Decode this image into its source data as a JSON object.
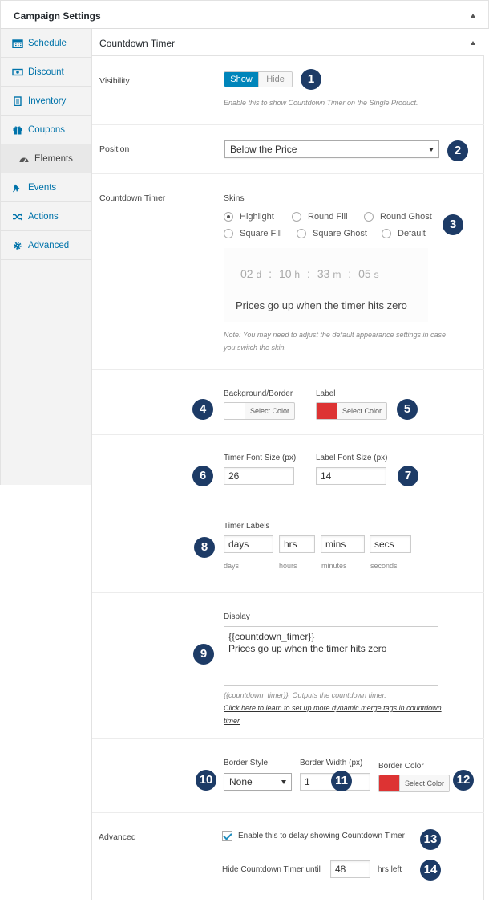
{
  "panel": {
    "title": "Campaign Settings"
  },
  "sidebar": {
    "items": [
      {
        "label": "Schedule",
        "icon": "calendar-icon"
      },
      {
        "label": "Discount",
        "icon": "money-icon"
      },
      {
        "label": "Inventory",
        "icon": "clipboard-icon"
      },
      {
        "label": "Coupons",
        "icon": "gift-icon"
      },
      {
        "label": "Elements",
        "icon": "dashboard-icon",
        "active": true
      },
      {
        "label": "Events",
        "icon": "pin-icon"
      },
      {
        "label": "Actions",
        "icon": "shuffle-icon"
      },
      {
        "label": "Advanced",
        "icon": "gear-icon"
      }
    ]
  },
  "section": {
    "title": "Countdown Timer"
  },
  "visibility": {
    "label": "Visibility",
    "show": "Show",
    "hide": "Hide",
    "help": "Enable this to show Countdown Timer on the Single Product."
  },
  "position": {
    "label": "Position",
    "value": "Below the Price"
  },
  "countdown": {
    "label": "Countdown Timer",
    "skins_label": "Skins",
    "skins": [
      "Highlight",
      "Round Fill",
      "Round Ghost",
      "Square Fill",
      "Square Ghost",
      "Default"
    ],
    "selected_skin": "Highlight",
    "preview": {
      "days": "02",
      "days_unit": "d",
      "hours": "10",
      "hours_unit": "h",
      "minutes": "33",
      "minutes_unit": "m",
      "seconds": "05",
      "seconds_unit": "s",
      "sep": ":",
      "message": "Prices go up when the timer hits zero"
    },
    "note_line1": "Note: You may need to adjust the default appearance settings in case",
    "note_line2": "you switch the skin."
  },
  "colors": {
    "bg_label": "Background/Border",
    "bg_button": "Select Color",
    "bg_color": "#ffffff",
    "label_label": "Label",
    "label_button": "Select Color",
    "label_color": "#dd3333"
  },
  "fonts": {
    "timer_label": "Timer Font Size (px)",
    "timer_value": "26",
    "label_label": "Label Font Size (px)",
    "label_value": "14"
  },
  "timer_labels": {
    "label": "Timer Labels",
    "fields": [
      {
        "value": "days",
        "caption": "days"
      },
      {
        "value": "hrs",
        "caption": "hours"
      },
      {
        "value": "mins",
        "caption": "minutes"
      },
      {
        "value": "secs",
        "caption": "seconds"
      }
    ]
  },
  "display": {
    "label": "Display",
    "line1": "{{countdown_timer}}",
    "line2": "Prices go up when the timer hits zero",
    "help": "{{countdown_timer}}: Outputs the countdown timer.",
    "link_line1": "Click here to learn to set up more dynamic merge tags in countdown",
    "link_line2": "timer"
  },
  "border": {
    "style_label": "Border Style",
    "style_value": "None",
    "width_label": "Border Width (px)",
    "width_value": "1",
    "color_label": "Border Color",
    "color_button": "Select Color",
    "color_value": "#dd3333"
  },
  "advanced": {
    "label": "Advanced",
    "delay_text": "Enable this to delay showing Countdown Timer",
    "delay_checked": true,
    "hide_label": "Hide Countdown Timer until",
    "hide_value": "48",
    "hide_unit": "hrs left"
  },
  "badges": [
    "1",
    "2",
    "3",
    "4",
    "5",
    "6",
    "7",
    "8",
    "9",
    "10",
    "11",
    "12",
    "13",
    "14"
  ]
}
